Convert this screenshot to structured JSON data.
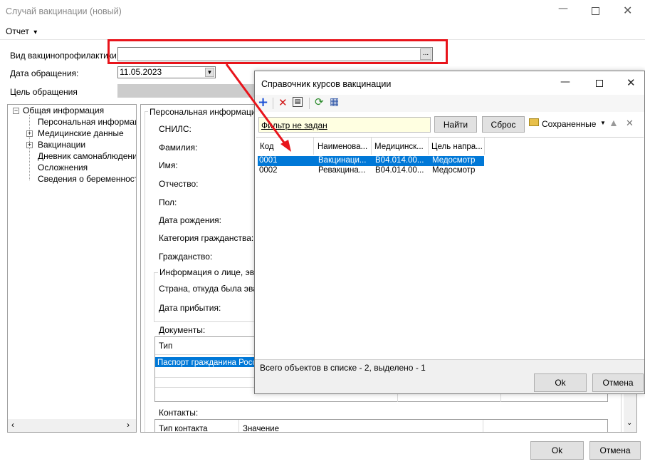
{
  "main_window": {
    "title": "Случай вакцинации (новый)",
    "menu": {
      "report_label": "Отчет",
      "report_arrow": "▾"
    },
    "fields": {
      "vaccination_type_label": "Вид вакцинопрофилактики",
      "vaccination_type_value": "",
      "browse_label": "...",
      "visit_date_label": "Дата обращения:",
      "visit_date_value": "11.05.2023",
      "visit_purpose_label": "Цель обращения"
    },
    "tree": {
      "root": "Общая информация",
      "items": [
        "Персональная информация",
        "Медицинские данные",
        "Вакцинации",
        "Дневник самонаблюдения",
        "Осложнения",
        "Сведения о беременности"
      ]
    },
    "personal": {
      "group_title": "Персональная информация п",
      "snils": "СНИЛС:",
      "last_name": "Фамилия:",
      "first_name": "Имя:",
      "patronymic": "Отчество:",
      "sex": "Пол:",
      "birth_date": "Дата рождения:",
      "citizenship_category": "Категория гражданства:",
      "citizenship": "Гражданство:",
      "evac_group": "Информация о лице, эваку",
      "country_from": "Страна, откуда была эвак",
      "arrival_date": "Дата прибытия:"
    },
    "documents": {
      "label": "Документы:",
      "col_type": "Тип",
      "row1": "Паспорт гражданина Росси"
    },
    "contacts": {
      "label": "Контакты:",
      "col_type": "Тип контакта",
      "col_value": "Значение"
    },
    "buttons": {
      "ok": "Ok",
      "cancel": "Отмена"
    }
  },
  "dialog": {
    "title": "Справочник курсов вакцинации",
    "filter_text": "Фильтр не задан",
    "find_button": "Найти",
    "reset_button": "Сброс",
    "saved_label": "Сохраненные",
    "columns": [
      "Код",
      "Наименова...",
      "Медицинск...",
      "Цель напра..."
    ],
    "rows": [
      [
        "0001",
        "Вакцинаци...",
        "B04.014.00...",
        "Медосмотр"
      ],
      [
        "0002",
        "Ревакцина...",
        "B04.014.00...",
        "Медосмотр"
      ]
    ],
    "status": "Всего объектов в списке - 2, выделено - 1",
    "buttons": {
      "ok": "Ok",
      "cancel": "Отмена"
    }
  },
  "colors": {
    "highlight_red": "#e8141b",
    "selection_blue": "#0078d7",
    "filter_yellow": "#ffffe1"
  }
}
